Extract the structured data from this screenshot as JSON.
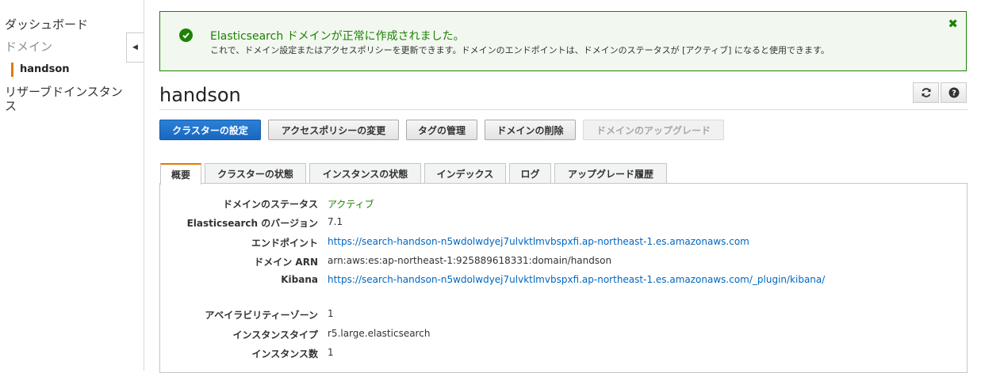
{
  "sidebar": {
    "dashboard": "ダッシュボード",
    "domains": "ドメイン",
    "selected_domain": "handson",
    "reserved": "リザーブドインスタンス"
  },
  "flash": {
    "title": "Elasticsearch ドメインが正常に作成されました。",
    "message": "これで、ドメイン設定またはアクセスポリシーを更新できます。ドメインのエンドポイントは、ドメインのステータスが [アクティブ] になると使用できます。",
    "close": "✖",
    "color": "#1d8102"
  },
  "page": {
    "title": "handson"
  },
  "toolbar": {
    "configure": "クラスターの設定",
    "access_policy": "アクセスポリシーの変更",
    "tags": "タグの管理",
    "delete": "ドメインの削除",
    "upgrade": "ドメインのアップグレード"
  },
  "tabs": [
    "概要",
    "クラスターの状態",
    "インスタンスの状態",
    "インデックス",
    "ログ",
    "アップグレード履歴"
  ],
  "details": {
    "status": {
      "label": "ドメインのステータス",
      "value": "アクティブ"
    },
    "version": {
      "label": "Elasticsearch のバージョン",
      "value": "7.1"
    },
    "endpoint": {
      "label": "エンドポイント",
      "value": "https://search-handson-n5wdolwdyej7ulvktlmvbspxfi.ap-northeast-1.es.amazonaws.com"
    },
    "arn": {
      "label": "ドメイン ARN",
      "value": "arn:aws:es:ap-northeast-1:925889618331:domain/handson"
    },
    "kibana": {
      "label": "Kibana",
      "value": "https://search-handson-n5wdolwdyej7ulvktlmvbspxfi.ap-northeast-1.es.amazonaws.com/_plugin/kibana/"
    },
    "az": {
      "label": "アベイラビリティーゾーン",
      "value": "1"
    },
    "instance_type": {
      "label": "インスタンスタイプ",
      "value": "r5.large.elasticsearch"
    },
    "instance_count": {
      "label": "インスタンス数",
      "value": "1"
    }
  },
  "colors": {
    "accent": "#e07b00",
    "link": "#0066c0",
    "primary": "#1a67c0",
    "success": "#1d8102"
  }
}
